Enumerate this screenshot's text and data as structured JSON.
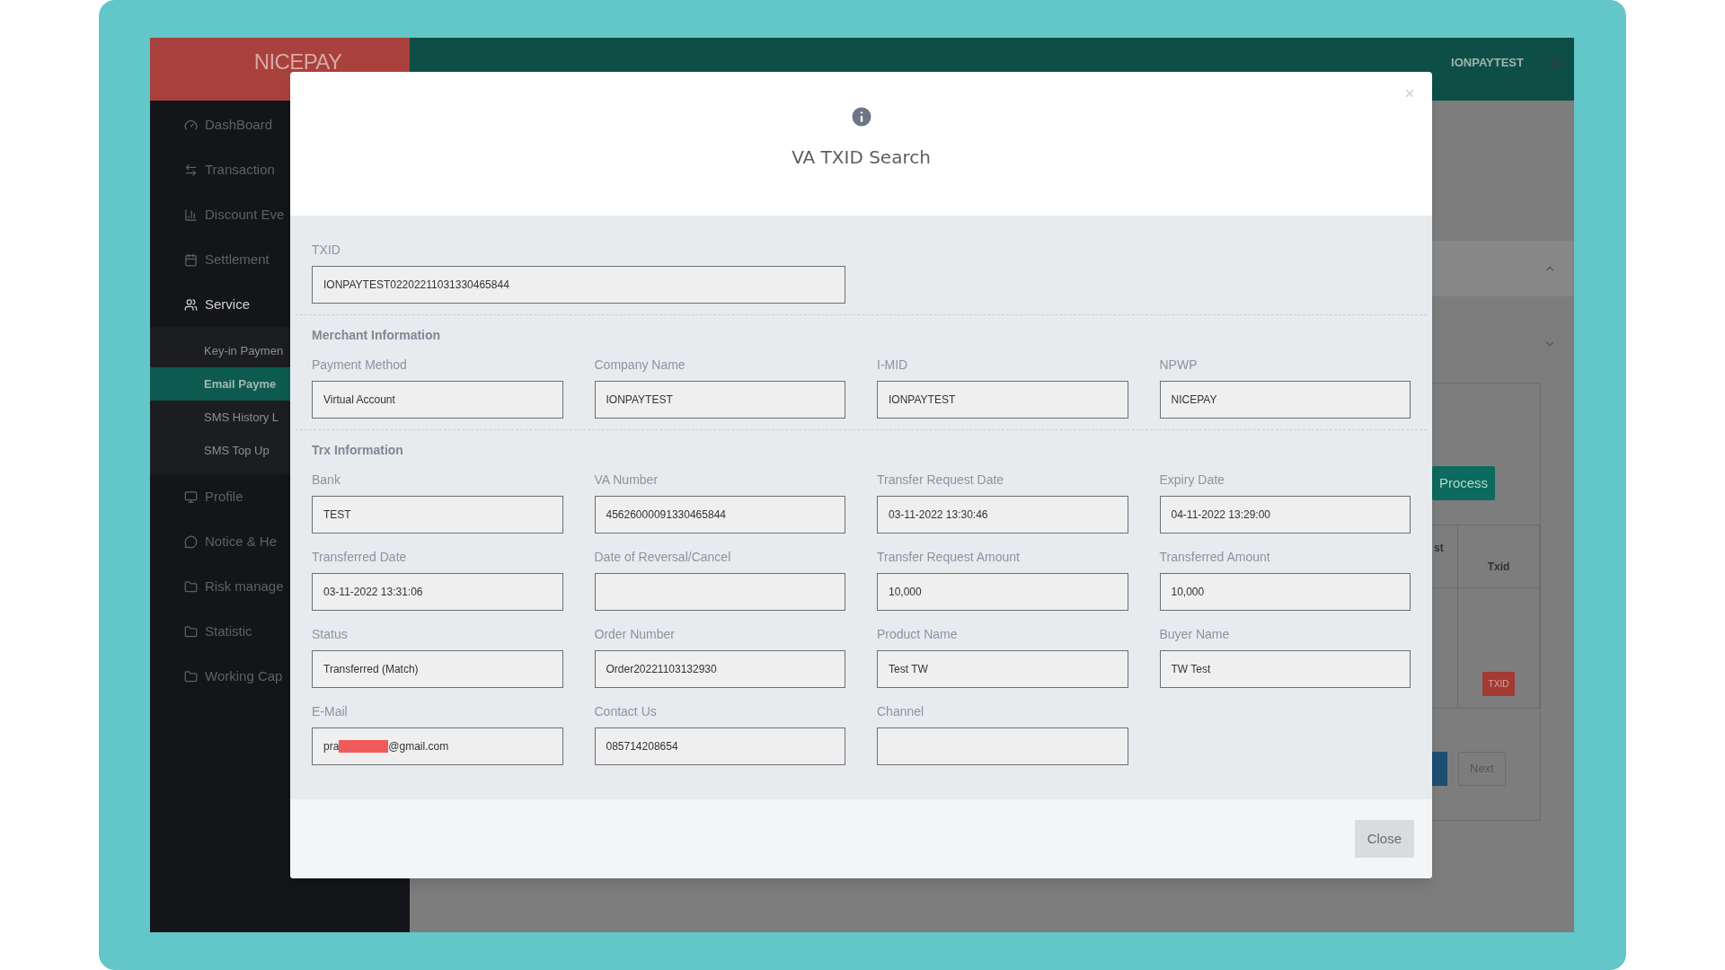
{
  "logo": "NICEPAY",
  "header": {
    "user": "IONPAYTEST"
  },
  "sidebar": {
    "items": [
      {
        "label": "DashBoard",
        "selected": false
      },
      {
        "label": "Transaction",
        "selected": false
      },
      {
        "label": "Discount Eve",
        "selected": false
      },
      {
        "label": "Settlement",
        "selected": false
      },
      {
        "label": "Service",
        "selected": true,
        "expanded": true,
        "children": [
          {
            "label": "Key-in Paymen",
            "selected": false
          },
          {
            "label": "Email Payme",
            "selected": true
          },
          {
            "label": "SMS History L",
            "selected": false
          },
          {
            "label": "SMS Top Up",
            "selected": false
          }
        ]
      },
      {
        "label": "Profile",
        "selected": false
      },
      {
        "label": "Notice & He",
        "selected": false
      },
      {
        "label": "Risk manage",
        "selected": false
      },
      {
        "label": "Statistic",
        "selected": false
      },
      {
        "label": "Working Cap",
        "selected": false
      }
    ]
  },
  "background": {
    "process_button": "Process",
    "table_columns": [
      "st",
      "Txid"
    ],
    "txid_badge": "TXID",
    "next_button": "Next"
  },
  "modal": {
    "title": "VA TXID Search",
    "txid": {
      "label": "TXID",
      "value": "IONPAYTEST02202211031330465844"
    },
    "sections": [
      {
        "title": "Merchant Information",
        "fields": [
          {
            "label": "Payment Method",
            "value": "Virtual Account"
          },
          {
            "label": "Company Name",
            "value": "IONPAYTEST"
          },
          {
            "label": "I-MID",
            "value": "IONPAYTEST"
          },
          {
            "label": "NPWP",
            "value": "NICEPAY"
          }
        ]
      },
      {
        "title": "Trx Information",
        "fields": [
          {
            "label": "Bank",
            "value": "TEST"
          },
          {
            "label": "VA Number",
            "value": "45626000091330465844"
          },
          {
            "label": "Transfer Request Date",
            "value": "03-11-2022 13:30:46"
          },
          {
            "label": "Expiry Date",
            "value": "04-11-2022 13:29:00"
          },
          {
            "label": "Transferred Date",
            "value": "03-11-2022 13:31:06"
          },
          {
            "label": "Date of Reversal/Cancel"
          },
          {
            "label": "Transfer Request Amount",
            "value": "10,000"
          },
          {
            "label": "Transferred Amount",
            "value": "10,000"
          },
          {
            "label": "Status",
            "value": "Transferred (Match)"
          },
          {
            "label": "Order Number",
            "value": "Order20221103132930"
          },
          {
            "label": "Product Name",
            "value": "Test TW"
          },
          {
            "label": "Buyer Name",
            "value": "TW Test"
          },
          {
            "label": "E-Mail",
            "value": "pra",
            "value_after": "@gmail.com",
            "redacted": true
          },
          {
            "label": "Contact Us",
            "value": "085714208654"
          },
          {
            "label": "Channel"
          }
        ]
      }
    ],
    "close_button": "Close"
  }
}
